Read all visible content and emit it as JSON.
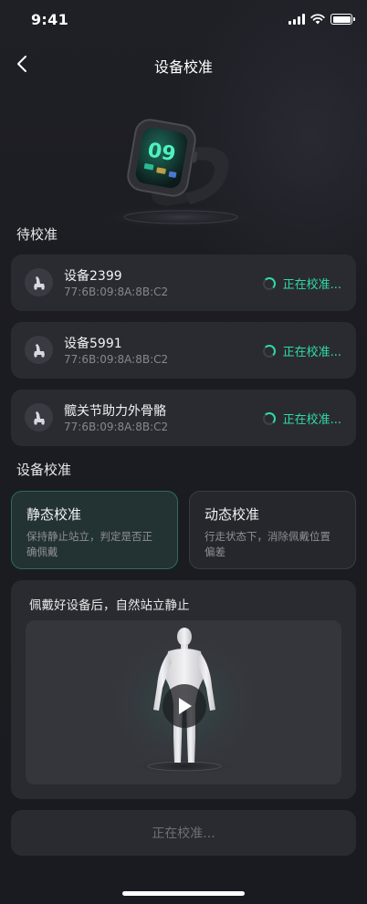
{
  "status_bar": {
    "time": "9:41"
  },
  "nav": {
    "title": "设备校准"
  },
  "watch": {
    "display_time": "09"
  },
  "pending": {
    "section_title": "待校准",
    "devices": [
      {
        "name": "设备2399",
        "mac": "77:6B:09:8A:8B:C2",
        "status": "正在校准..."
      },
      {
        "name": "设备5991",
        "mac": "77:6B:09:8A:8B:C2",
        "status": "正在校准..."
      },
      {
        "name": "髋关节助力外骨骼",
        "mac": "77:6B:09:8A:8B:C2",
        "status": "正在校准..."
      }
    ]
  },
  "calibration": {
    "section_title": "设备校准",
    "modes": [
      {
        "title": "静态校准",
        "desc": "保持静止站立，判定是否正确佩戴",
        "selected": true
      },
      {
        "title": "动态校准",
        "desc": "行走状态下，消除佩戴位置偏差",
        "selected": false
      }
    ]
  },
  "instruction": {
    "title": "佩戴好设备后，自然站立静止"
  },
  "bottom_button": {
    "label": "正在校准..."
  },
  "colors": {
    "accent": "#2fd9a8",
    "background": "#1b1c21",
    "card": "#2a2b31"
  },
  "icons": {
    "back": "chevron-left-icon",
    "device": "exoskeleton-icon",
    "status": "spinner-icon",
    "play": "play-icon"
  }
}
